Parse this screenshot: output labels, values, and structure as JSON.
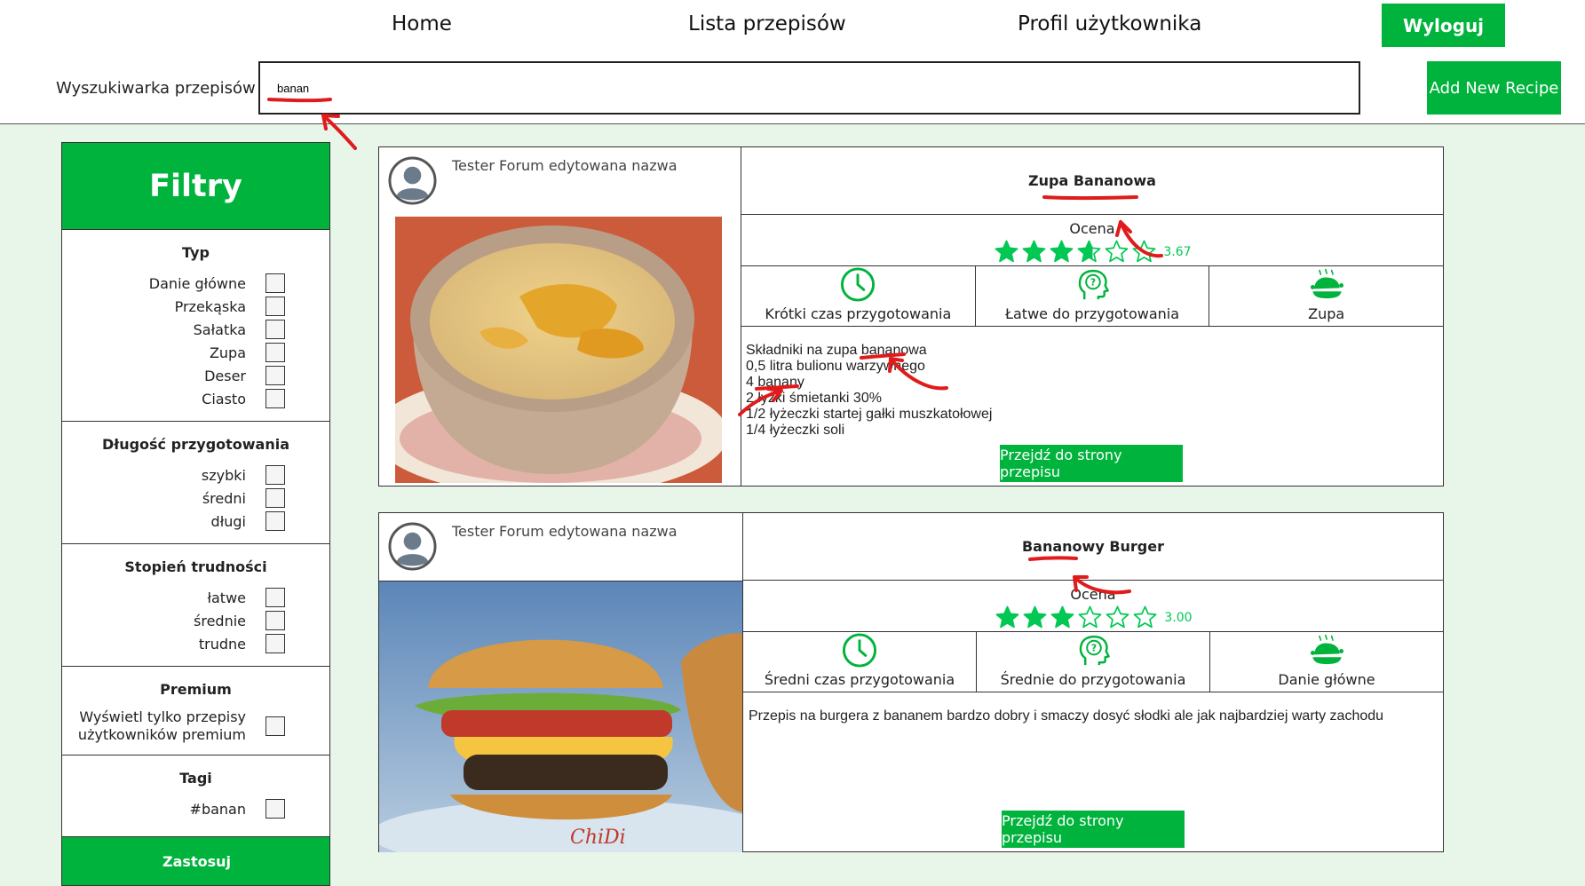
{
  "nav": {
    "home": "Home",
    "recipes": "Lista przepisów",
    "profile": "Profil użytkownika",
    "logout": "Wyloguj"
  },
  "search": {
    "label": "Wyszukiwarka przepisów",
    "value": "banan",
    "add_button": "Add New Recipe"
  },
  "filters": {
    "title": "Filtry",
    "type": {
      "title": "Typ",
      "options": [
        "Danie główne",
        "Przekąska",
        "Sałatka",
        "Zupa",
        "Deser",
        "Ciasto"
      ]
    },
    "time": {
      "title": "Długość przygotowania",
      "options": [
        "szybki",
        "średni",
        "długi"
      ]
    },
    "difficulty": {
      "title": "Stopień trudności",
      "options": [
        "łatwe",
        "średnie",
        "trudne"
      ]
    },
    "premium": {
      "title": "Premium",
      "option": "Wyświetl tylko przepisy użytkowników premium"
    },
    "tags": {
      "title": "Tagi",
      "options": [
        "#banan"
      ]
    },
    "apply": "Zastosuj"
  },
  "recipes": [
    {
      "author": "Tester Forum edytowana nazwa",
      "title": "Zupa Bananowa",
      "rating_label": "Ocena",
      "rating": 3.67,
      "rating_text": "3.67",
      "time": "Krótki czas przygotowania",
      "difficulty": "Łatwe do przygotowania",
      "category": "Zupa",
      "description": [
        "Składniki na zupa bananowa",
        "0,5 litra bulionu warzywnego",
        "4 banany",
        "2 łyżki śmietanki 30%",
        "1/2 łyżeczki startej gałki muszkatołowej",
        "1/4 łyżeczki soli"
      ],
      "button": "Przejdź do strony przepisu"
    },
    {
      "author": "Tester Forum edytowana nazwa",
      "title": "Bananowy Burger",
      "rating_label": "Ocena",
      "rating": 3.0,
      "rating_text": "3.00",
      "time": "Średni czas przygotowania",
      "difficulty": "Średnie do przygotowania",
      "category": "Danie główne",
      "description": [
        "Przepis na burgera z bananem bardzo dobry i smaczy dosyć słodki ale jak najbardziej warty zachodu"
      ],
      "button": "Przejdź do strony przepisu",
      "photo_watermark": "ChiDi"
    }
  ],
  "icons": {
    "time": "clock-icon",
    "difficulty": "head-question-icon",
    "category": "roast-chicken-icon",
    "avatar": "user-avatar-icon",
    "star": "star-icon"
  },
  "colors": {
    "accent": "#00b33c",
    "background": "#e8f5e9",
    "star": "#00c853",
    "annotation": "#e01b1b"
  }
}
